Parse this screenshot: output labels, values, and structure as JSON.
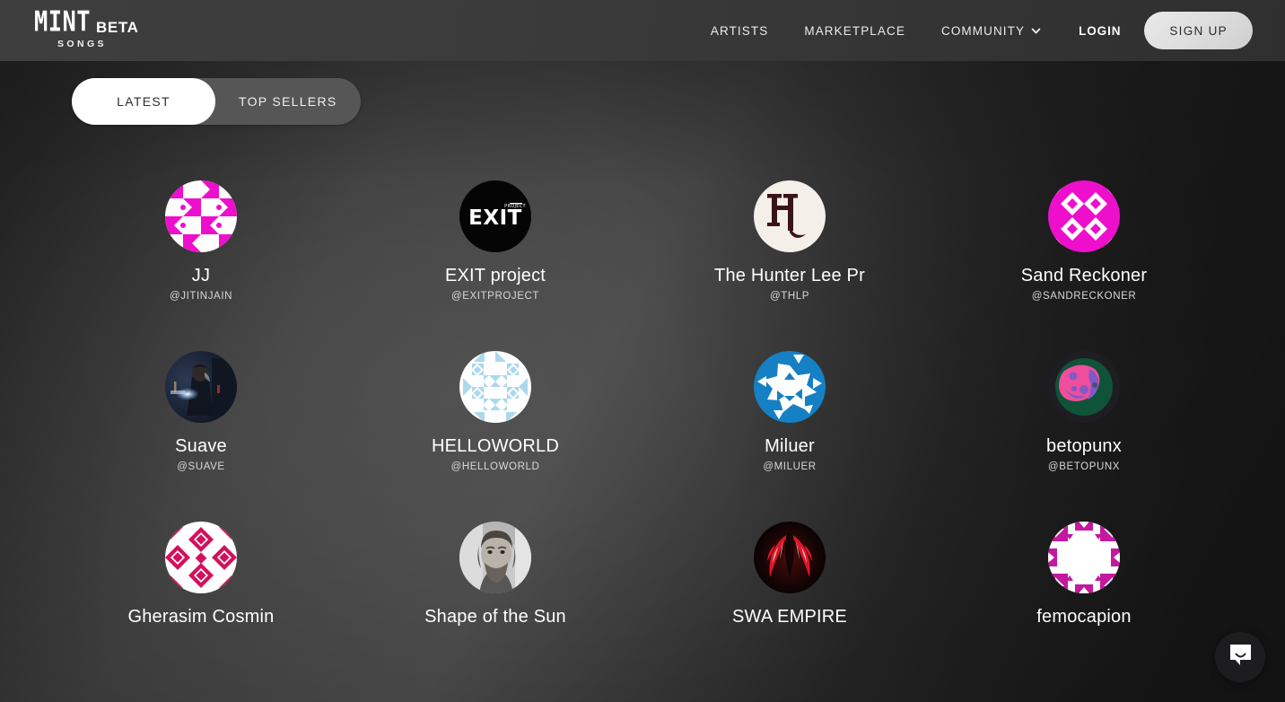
{
  "brand": {
    "name": "MINT",
    "badge": "BETA",
    "sub": "SONGS"
  },
  "nav": {
    "items": [
      {
        "label": "ARTISTS",
        "has_caret": false
      },
      {
        "label": "MARKETPLACE",
        "has_caret": false
      },
      {
        "label": "COMMUNITY",
        "has_caret": true
      }
    ],
    "login_label": "LOGIN",
    "signup_label": "SIGN UP",
    "caret_icon": "chevron-down-icon"
  },
  "tabs": {
    "items": [
      {
        "label": "LATEST",
        "active": true
      },
      {
        "label": "TOP SELLERS",
        "active": false
      }
    ]
  },
  "artists": [
    {
      "name": "JJ",
      "handle": "@JITINJAIN",
      "avatar": "identicon-magenta"
    },
    {
      "name": "EXIT project",
      "handle": "@EXITPROJECT",
      "avatar": "exit-logo"
    },
    {
      "name": "The Hunter Lee Pr",
      "handle": "@THLP",
      "avatar": "hl-monogram"
    },
    {
      "name": "Sand Reckoner",
      "handle": "@SANDRECKONER",
      "avatar": "identicon-magenta-2"
    },
    {
      "name": "Suave",
      "handle": "@SUAVE",
      "avatar": "photo-suave"
    },
    {
      "name": "HELLOWORLD",
      "handle": "@HELLOWORLD",
      "avatar": "identicon-lightblue"
    },
    {
      "name": "Miluer",
      "handle": "@MILUER",
      "avatar": "identicon-blue"
    },
    {
      "name": "betopunx",
      "handle": "@BETOPUNX",
      "avatar": "planet-pink"
    },
    {
      "name": "Gherasim Cosmin",
      "handle": "",
      "avatar": "identicon-crimson"
    },
    {
      "name": "Shape of the Sun",
      "handle": "",
      "avatar": "photo-bearded-man"
    },
    {
      "name": "SWA EMPIRE",
      "handle": "",
      "avatar": "red-wings"
    },
    {
      "name": "femocapion",
      "handle": "",
      "avatar": "identicon-magenta-3"
    }
  ],
  "chat": {
    "icon": "chat-bubble-icon"
  },
  "colors": {
    "accent_magenta": "#ED0FCB",
    "accent_blue": "#1580C4",
    "accent_crimson": "#D3115B",
    "page_bg": "#4e4e4e",
    "header_bg": "#3a3a3a",
    "signup_bg": "#dcdcdc",
    "tab_active_bg": "#ffffff",
    "tab_track_bg": "#565656"
  }
}
